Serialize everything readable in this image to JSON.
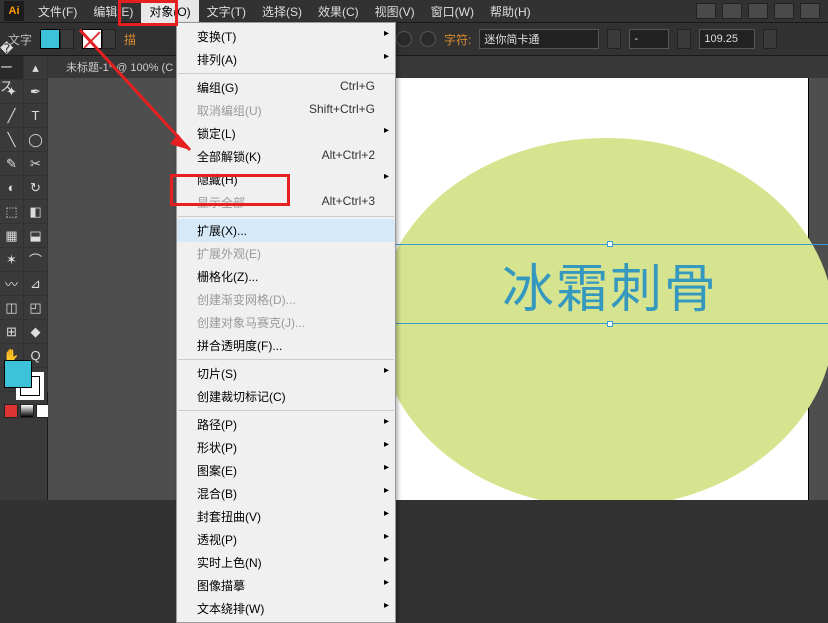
{
  "logo": "Ai",
  "menus": [
    "文件(F)",
    "编辑(E)",
    "对象(O)",
    "文字(T)",
    "选择(S)",
    "效果(C)",
    "视图(V)",
    "窗口(W)",
    "帮助(H)"
  ],
  "active_menu_index": 2,
  "control": {
    "tool_label": "文字",
    "zoom_value": "100%",
    "font_prompt": "字符:",
    "font_name": "迷你简卡通",
    "num_value": "109.25"
  },
  "doc_tab": "未标题-1* @ 100% (C",
  "dropdown": [
    {
      "label": "变换(T)",
      "sub": true
    },
    {
      "label": "排列(A)",
      "sub": true
    },
    {
      "sep": true
    },
    {
      "label": "编组(G)",
      "shortcut": "Ctrl+G"
    },
    {
      "label": "取消编组(U)",
      "shortcut": "Shift+Ctrl+G",
      "disabled": true
    },
    {
      "label": "锁定(L)",
      "sub": true
    },
    {
      "label": "全部解锁(K)",
      "shortcut": "Alt+Ctrl+2"
    },
    {
      "label": "隐藏(H)",
      "sub": true
    },
    {
      "label": "显示全部",
      "shortcut": "Alt+Ctrl+3",
      "disabled": true
    },
    {
      "sep": true
    },
    {
      "label": "扩展(X)...",
      "hover": true
    },
    {
      "label": "扩展外观(E)",
      "disabled": true
    },
    {
      "label": "栅格化(Z)..."
    },
    {
      "label": "创建渐变网格(D)...",
      "disabled": true
    },
    {
      "label": "创建对象马赛克(J)...",
      "disabled": true
    },
    {
      "label": "拼合透明度(F)..."
    },
    {
      "sep": true
    },
    {
      "label": "切片(S)",
      "sub": true
    },
    {
      "label": "创建裁切标记(C)"
    },
    {
      "sep": true
    },
    {
      "label": "路径(P)",
      "sub": true
    },
    {
      "label": "形状(P)",
      "sub": true
    },
    {
      "label": "图案(E)",
      "sub": true
    },
    {
      "label": "混合(B)",
      "sub": true
    },
    {
      "label": "封套扭曲(V)",
      "sub": true
    },
    {
      "label": "透视(P)",
      "sub": true
    },
    {
      "label": "实时上色(N)",
      "sub": true
    },
    {
      "label": "图像描摹",
      "sub": true
    },
    {
      "label": "文本绕排(W)",
      "sub": true
    }
  ],
  "canvas_text": "冰霜刺骨",
  "tools_glyphs": [
    "�ース",
    "▴",
    "✦",
    "✒",
    "╱",
    "T",
    "╲",
    "◯",
    "✎",
    "✂",
    "◐",
    "↻",
    "⬚",
    "◧",
    "▦",
    "⬓",
    "✶",
    "⌒",
    "〰",
    "⊿",
    "◫",
    "◰",
    "⊞",
    "◆",
    "✋",
    "Q",
    "▭",
    "⬛"
  ]
}
